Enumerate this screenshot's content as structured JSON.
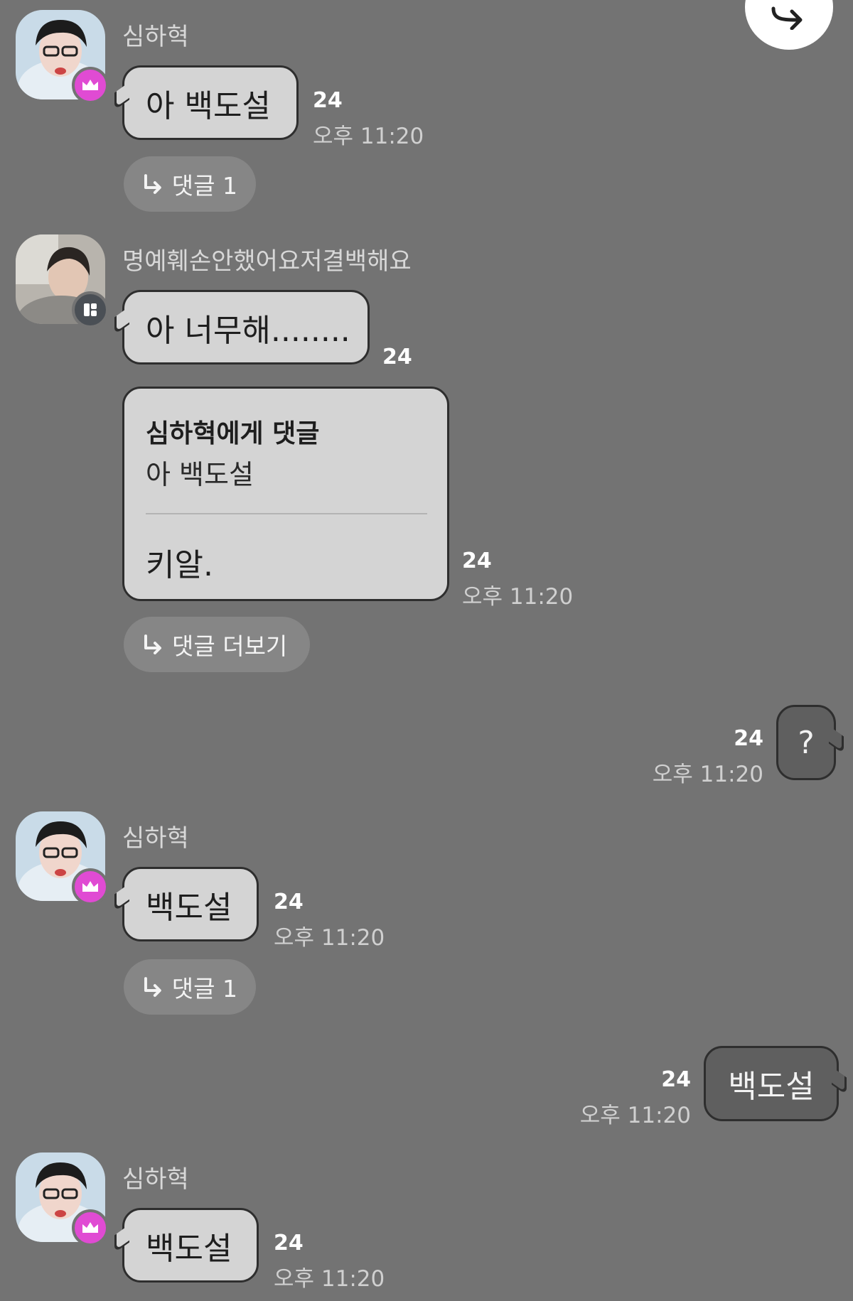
{
  "icons": {
    "share": "share-arrow-icon",
    "reply_arrow": "reply-arrow-icon",
    "crown": "crown-icon",
    "manager": "manager-icon"
  },
  "colors": {
    "background": "#737373",
    "bubble_in": "#d4d4d4",
    "bubble_out": "#5f5f5f",
    "crown_badge": "#e04bd3",
    "reply_pill": "#868686"
  },
  "messages": [
    {
      "sender": "심하혁",
      "text": "아 백도설",
      "count": "24",
      "time": "오후 11:20",
      "replies_label": "댓글 1"
    },
    {
      "sender": "명예훼손안했어요저결백해요",
      "text": "아 너무해........",
      "count": "24"
    },
    {
      "reply_to_label": "심하혁에게 댓글",
      "reply_to_text": "아 백도설",
      "text": "키알.",
      "count": "24",
      "time": "오후 11:20",
      "replies_label": "댓글 더보기"
    },
    {
      "text": "?",
      "count": "24",
      "time": "오후 11:20"
    },
    {
      "sender": "심하혁",
      "text": "백도설",
      "count": "24",
      "time": "오후 11:20",
      "replies_label": "댓글 1"
    },
    {
      "text": "백도설",
      "count": "24",
      "time": "오후 11:20"
    },
    {
      "sender": "심하혁",
      "text": "백도설",
      "count": "24",
      "time": "오후 11:20"
    }
  ]
}
